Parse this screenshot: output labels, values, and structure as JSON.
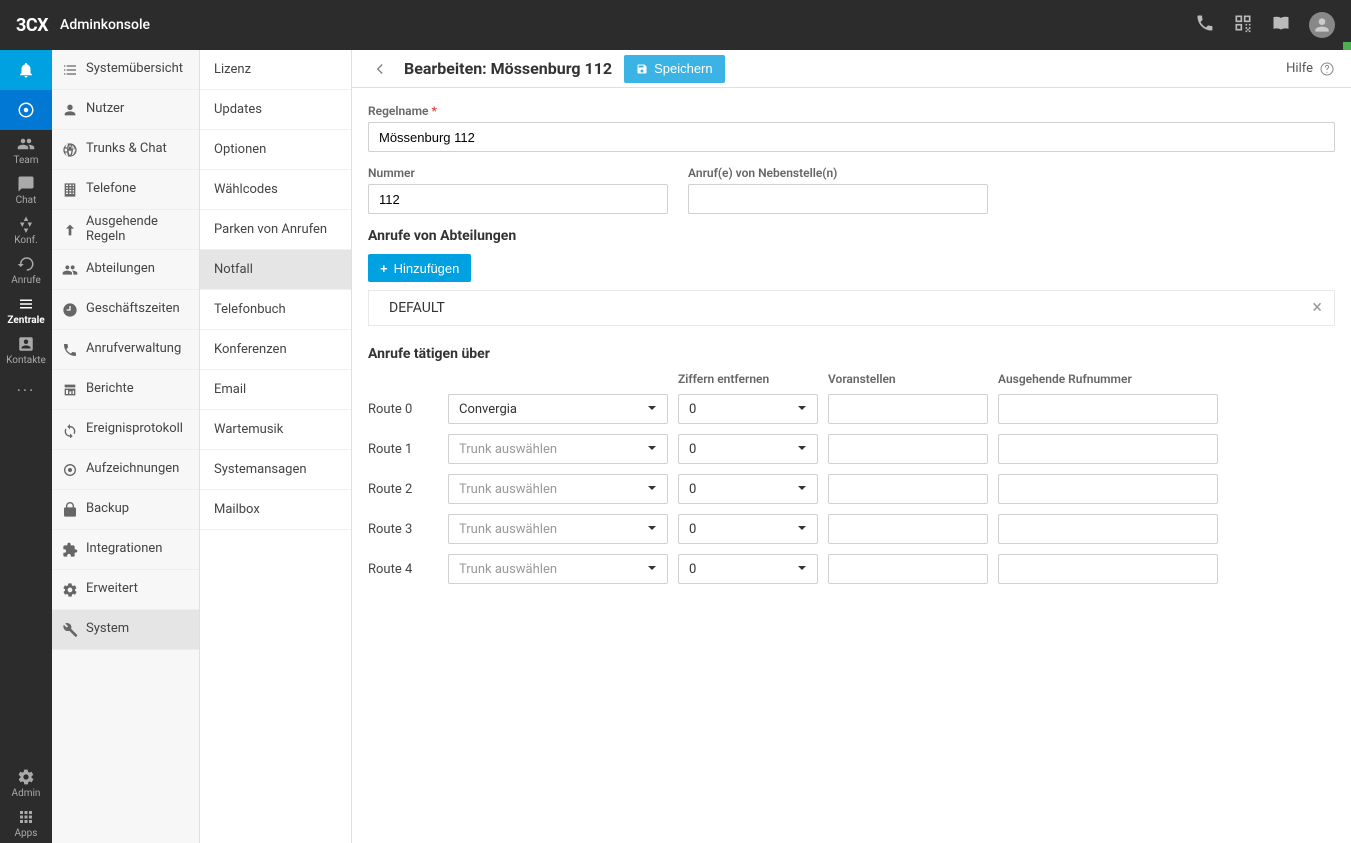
{
  "topbar": {
    "logo_brand": "3CX",
    "title": "Adminkonsole"
  },
  "rail": {
    "items": [
      {
        "label": "",
        "icon": "bell",
        "active": true
      },
      {
        "label": "",
        "icon": "chrome"
      },
      {
        "label": "Team",
        "icon": "users"
      },
      {
        "label": "Chat",
        "icon": "chat"
      },
      {
        "label": "Konf.",
        "icon": "conf"
      },
      {
        "label": "Anrufe",
        "icon": "history"
      },
      {
        "label": "Zentrale",
        "icon": "switch",
        "bold": true
      },
      {
        "label": "Kontakte",
        "icon": "contacts"
      },
      {
        "label": "···",
        "icon": "more"
      }
    ],
    "bottom": [
      {
        "label": "Admin",
        "icon": "gear"
      },
      {
        "label": "Apps",
        "icon": "apps"
      }
    ]
  },
  "sidebar1": {
    "items": [
      {
        "label": "Systemübersicht",
        "icon": "list"
      },
      {
        "label": "Nutzer",
        "icon": "user"
      },
      {
        "label": "Trunks & Chat",
        "icon": "globe"
      },
      {
        "label": "Telefone",
        "icon": "building"
      },
      {
        "label": "Ausgehende Regeln",
        "icon": "arrow-up"
      },
      {
        "label": "Abteilungen",
        "icon": "users"
      },
      {
        "label": "Geschäftszeiten",
        "icon": "clock"
      },
      {
        "label": "Anrufverwaltung",
        "icon": "phone"
      },
      {
        "label": "Berichte",
        "icon": "report"
      },
      {
        "label": "Ereignisprotokoll",
        "icon": "refresh"
      },
      {
        "label": "Aufzeichnungen",
        "icon": "record"
      },
      {
        "label": "Backup",
        "icon": "backup"
      },
      {
        "label": "Integrationen",
        "icon": "puzzle"
      },
      {
        "label": "Erweitert",
        "icon": "gear"
      },
      {
        "label": "System",
        "icon": "wrench",
        "selected": true
      }
    ]
  },
  "sidebar2": {
    "items": [
      {
        "label": "Lizenz"
      },
      {
        "label": "Updates"
      },
      {
        "label": "Optionen"
      },
      {
        "label": "Wählcodes"
      },
      {
        "label": "Parken von Anrufen"
      },
      {
        "label": "Notfall",
        "selected": true
      },
      {
        "label": "Telefonbuch"
      },
      {
        "label": "Konferenzen"
      },
      {
        "label": "Email"
      },
      {
        "label": "Wartemusik"
      },
      {
        "label": "Systemansagen"
      },
      {
        "label": "Mailbox"
      }
    ]
  },
  "main": {
    "page_title": "Bearbeiten: Mössenburg 112",
    "save_label": "Speichern",
    "help_label": "Hilfe",
    "field_rulename_label": "Regelname",
    "field_rulename_value": "Mössenburg 112",
    "field_number_label": "Nummer",
    "field_number_value": "112",
    "field_ext_label": "Anruf(e) von Nebenstelle(n)",
    "field_ext_value": "",
    "section_dept": "Anrufe von Abteilungen",
    "add_label": "Hinzufügen",
    "dept_value": "DEFAULT",
    "section_routes": "Anrufe tätigen über",
    "route_headers": {
      "digits": "Ziffern entfernen",
      "prepend": "Voranstellen",
      "outnum": "Ausgehende Rufnummer"
    },
    "trunk_placeholder": "Trunk auswählen",
    "routes": [
      {
        "label": "Route 0",
        "trunk": "Convergia",
        "digits": "0",
        "prepend": "",
        "outnum": ""
      },
      {
        "label": "Route 1",
        "trunk": "",
        "digits": "0",
        "prepend": "",
        "outnum": ""
      },
      {
        "label": "Route 2",
        "trunk": "",
        "digits": "0",
        "prepend": "",
        "outnum": ""
      },
      {
        "label": "Route 3",
        "trunk": "",
        "digits": "0",
        "prepend": "",
        "outnum": ""
      },
      {
        "label": "Route 4",
        "trunk": "",
        "digits": "0",
        "prepend": "",
        "outnum": ""
      }
    ]
  }
}
